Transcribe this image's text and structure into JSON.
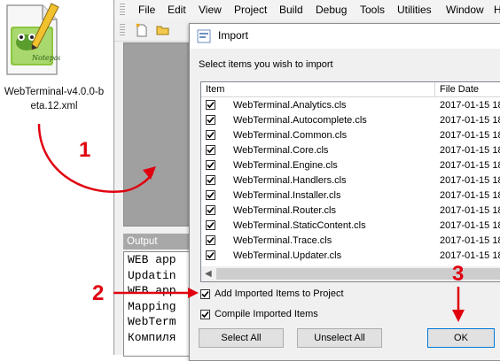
{
  "desktop_icon": {
    "label": "WebTerminal-v4.0.0-beta.12.xml",
    "icon": "notepad-plus-plus-file-icon"
  },
  "menu": [
    "File",
    "Edit",
    "View",
    "Project",
    "Build",
    "Debug",
    "Tools",
    "Utilities",
    "Window",
    "H"
  ],
  "output_panel": {
    "title": "Output",
    "lines": [
      "WEB app",
      "Updatin",
      "WEB app",
      "Mapping",
      "WebTerm",
      "Компиля"
    ]
  },
  "dialog": {
    "title": "Import",
    "instruction": "Select items you wish to import",
    "columns": [
      "Item",
      "File Date"
    ],
    "items": [
      {
        "name": "WebTerminal.Analytics.cls",
        "date": "2017-01-15 18",
        "checked": true
      },
      {
        "name": "WebTerminal.Autocomplete.cls",
        "date": "2017-01-15 18",
        "checked": true
      },
      {
        "name": "WebTerminal.Common.cls",
        "date": "2017-01-15 18",
        "checked": true
      },
      {
        "name": "WebTerminal.Core.cls",
        "date": "2017-01-15 18",
        "checked": true
      },
      {
        "name": "WebTerminal.Engine.cls",
        "date": "2017-01-15 18",
        "checked": true
      },
      {
        "name": "WebTerminal.Handlers.cls",
        "date": "2017-01-15 18",
        "checked": true
      },
      {
        "name": "WebTerminal.Installer.cls",
        "date": "2017-01-15 18",
        "checked": true
      },
      {
        "name": "WebTerminal.Router.cls",
        "date": "2017-01-15 18",
        "checked": true
      },
      {
        "name": "WebTerminal.StaticContent.cls",
        "date": "2017-01-15 18",
        "checked": true
      },
      {
        "name": "WebTerminal.Trace.cls",
        "date": "2017-01-15 18",
        "checked": true
      },
      {
        "name": "WebTerminal.Updater.cls",
        "date": "2017-01-15 18",
        "checked": true
      }
    ],
    "options": {
      "add_to_project": {
        "label": "Add Imported Items to Project",
        "checked": true
      },
      "compile": {
        "label": "Compile Imported Items",
        "checked": true
      }
    },
    "buttons": {
      "select_all": "Select All",
      "unselect_all": "Unselect All",
      "ok": "OK"
    }
  },
  "annotations": {
    "step1": "1",
    "step2": "2",
    "step3": "3",
    "color": "#e0000f"
  }
}
